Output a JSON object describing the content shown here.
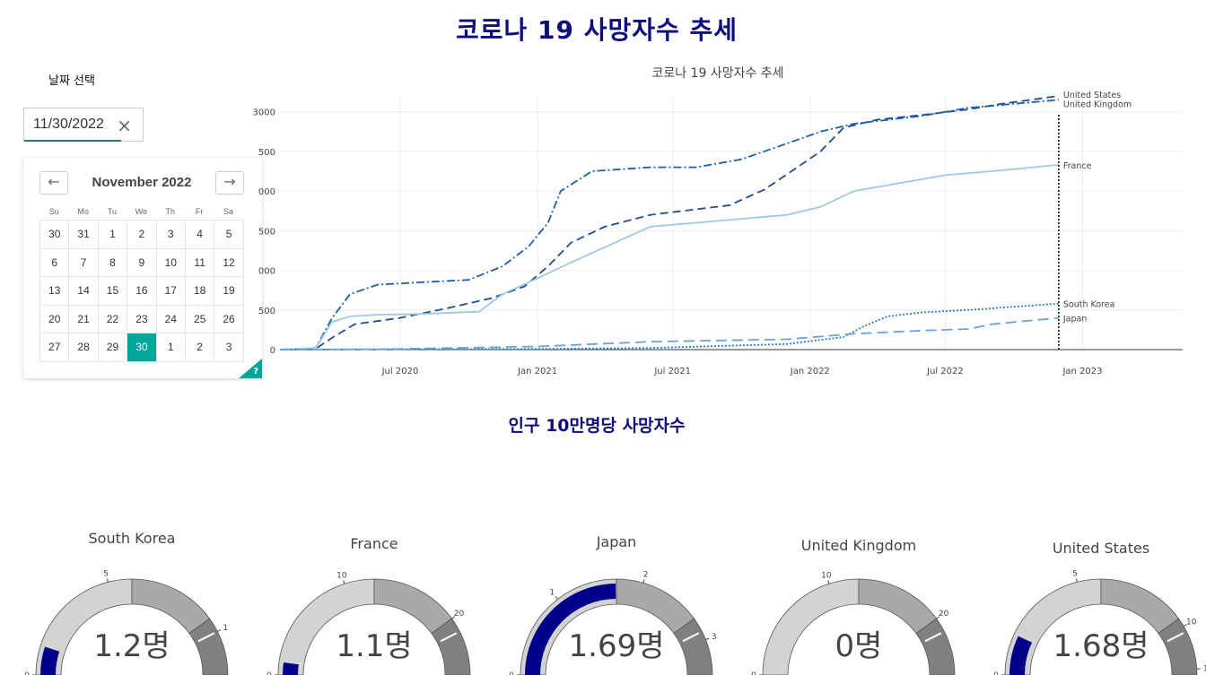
{
  "page": {
    "title": "코로나 19 사망자수 추세"
  },
  "date_picker": {
    "label": "날짜 선택",
    "value": "11/30/2022",
    "clear_icon": "close-icon",
    "calendar": {
      "month_label": "November 2022",
      "prev_icon": "arrow-left-icon",
      "next_icon": "arrow-right-icon",
      "weekdays": [
        "Su",
        "Mo",
        "Tu",
        "We",
        "Th",
        "Fr",
        "Sa"
      ],
      "days": [
        "30",
        "31",
        "1",
        "2",
        "3",
        "4",
        "5",
        "6",
        "7",
        "8",
        "9",
        "10",
        "11",
        "12",
        "13",
        "14",
        "15",
        "16",
        "17",
        "18",
        "19",
        "20",
        "21",
        "22",
        "23",
        "24",
        "25",
        "26",
        "27",
        "28",
        "29",
        "30",
        "1",
        "2",
        "3"
      ],
      "selected_index": 31,
      "help_label": "?",
      "selected_color": "#00a699"
    }
  },
  "chart_data": {
    "type": "line",
    "title": "코로나 19 사망자수 추세",
    "x_ticks": [
      "Jul 2020",
      "Jan 2021",
      "Jul 2021",
      "Jan 2022",
      "Jul 2022",
      "Jan 2023"
    ],
    "y_ticks": [
      "0",
      "500",
      "1000",
      "1500",
      "2000",
      "2500",
      "3000"
    ],
    "y_tick_visible": [
      "0",
      "500",
      "000",
      "500",
      "000",
      "500",
      "3000"
    ],
    "x_range": [
      "2020-01-22",
      "2023-05-15"
    ],
    "ylim": [
      0,
      3200
    ],
    "vertical_marker_date": "2022-11-30",
    "grid": true,
    "series": [
      {
        "name": "United States",
        "color": "#1f4e8c",
        "dash": "dash",
        "x": [
          "2020-01-22",
          "2020-03-10",
          "2020-04-01",
          "2020-05-01",
          "2020-07-01",
          "2020-09-01",
          "2020-11-01",
          "2020-12-15",
          "2021-01-15",
          "2021-02-15",
          "2021-04-01",
          "2021-06-01",
          "2021-08-01",
          "2021-09-15",
          "2021-11-01",
          "2021-12-15",
          "2022-01-15",
          "2022-02-15",
          "2022-04-01",
          "2022-06-01",
          "2022-08-01",
          "2022-09-15",
          "2022-11-30"
        ],
        "y": [
          0,
          10,
          150,
          320,
          400,
          520,
          650,
          800,
          1050,
          1350,
          1550,
          1700,
          1770,
          1820,
          2020,
          2300,
          2500,
          2800,
          2900,
          2960,
          3030,
          3100,
          3200
        ]
      },
      {
        "name": "United Kingdom",
        "color": "#1f5fa6",
        "dash": "dashdot",
        "x": [
          "2020-01-22",
          "2020-03-10",
          "2020-04-01",
          "2020-04-25",
          "2020-06-01",
          "2020-08-01",
          "2020-10-01",
          "2020-11-15",
          "2020-12-20",
          "2021-01-15",
          "2021-02-01",
          "2021-03-15",
          "2021-06-01",
          "2021-08-01",
          "2021-10-01",
          "2021-12-01",
          "2022-01-15",
          "2022-03-01",
          "2022-06-01",
          "2022-08-01",
          "2022-11-30"
        ],
        "y": [
          0,
          20,
          400,
          700,
          820,
          850,
          880,
          1050,
          1300,
          1600,
          2000,
          2250,
          2300,
          2300,
          2400,
          2600,
          2750,
          2850,
          2950,
          3050,
          3150
        ]
      },
      {
        "name": "France",
        "color": "#9ec9e2",
        "dash": "solid",
        "x": [
          "2020-01-22",
          "2020-03-10",
          "2020-04-01",
          "2020-04-25",
          "2020-06-01",
          "2020-08-01",
          "2020-10-15",
          "2020-11-15",
          "2021-01-01",
          "2021-02-15",
          "2021-04-15",
          "2021-06-01",
          "2021-08-01",
          "2021-10-01",
          "2021-12-01",
          "2022-01-15",
          "2022-03-01",
          "2022-05-01",
          "2022-07-01",
          "2022-09-01",
          "2022-11-30"
        ],
        "y": [
          0,
          20,
          350,
          420,
          440,
          450,
          480,
          700,
          900,
          1100,
          1350,
          1550,
          1600,
          1650,
          1700,
          1800,
          2000,
          2100,
          2200,
          2250,
          2330
        ]
      },
      {
        "name": "South Korea",
        "color": "#2f7bb8",
        "dash": "dot",
        "x": [
          "2020-01-22",
          "2020-06-01",
          "2021-01-01",
          "2021-06-01",
          "2021-12-01",
          "2022-02-15",
          "2022-03-15",
          "2022-04-15",
          "2022-06-01",
          "2022-08-01",
          "2022-11-30"
        ],
        "y": [
          0,
          3,
          8,
          20,
          70,
          160,
          300,
          420,
          470,
          500,
          580
        ]
      },
      {
        "name": "Japan",
        "color": "#6aa3d6",
        "dash": "longdash",
        "x": [
          "2020-01-22",
          "2020-06-01",
          "2021-01-01",
          "2021-06-01",
          "2021-12-01",
          "2022-03-01",
          "2022-06-01",
          "2022-08-01",
          "2022-09-01",
          "2022-11-30"
        ],
        "y": [
          0,
          5,
          40,
          100,
          130,
          200,
          240,
          260,
          320,
          400
        ]
      }
    ]
  },
  "gauges": {
    "section_title": "인구 10만명당 사망자수",
    "bar_color": "#00008b",
    "items": [
      {
        "name": "South Korea",
        "value_text": "1.2명",
        "value": 1.2,
        "max": 12,
        "ticks": [
          "0",
          "5",
          "1"
        ],
        "tick_fracs": [
          0,
          0.42,
          0.85
        ]
      },
      {
        "name": "France",
        "value_text": "1.1명",
        "value": 1.1,
        "max": 25,
        "ticks": [
          "0",
          "10",
          "20"
        ],
        "tick_fracs": [
          0,
          0.4,
          0.8
        ]
      },
      {
        "name": "Japan",
        "value_text": "1.69명",
        "value": 1.69,
        "max": 3.4,
        "ticks": [
          "0",
          "1",
          "2",
          "3"
        ],
        "tick_fracs": [
          0,
          0.29,
          0.59,
          0.88
        ]
      },
      {
        "name": "United Kingdom",
        "value_text": "0명",
        "value": 0,
        "max": 25,
        "ticks": [
          "0",
          "10",
          "20"
        ],
        "tick_fracs": [
          0,
          0.4,
          0.8
        ]
      },
      {
        "name": "United States",
        "value_text": "1.68명",
        "value": 1.68,
        "max": 12,
        "ticks": [
          "0",
          "5",
          "10",
          "1"
        ],
        "tick_fracs": [
          0,
          0.42,
          0.83,
          0.98
        ]
      }
    ]
  }
}
